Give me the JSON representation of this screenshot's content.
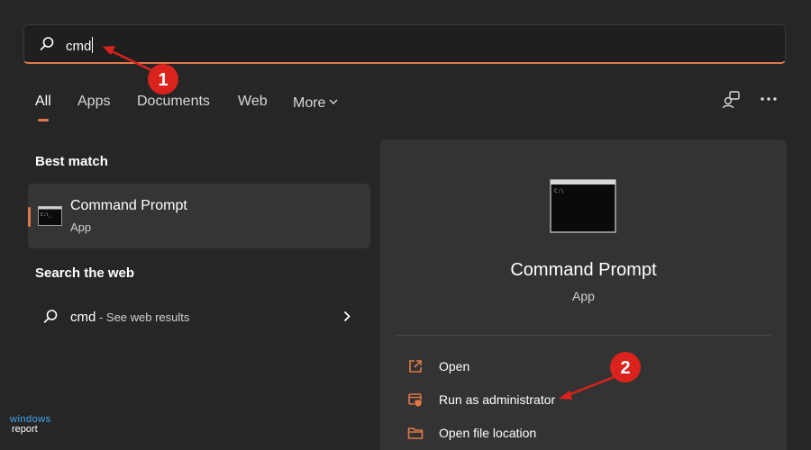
{
  "search": {
    "query": "cmd"
  },
  "tabs": [
    {
      "label": "All"
    },
    {
      "label": "Apps"
    },
    {
      "label": "Documents"
    },
    {
      "label": "Web"
    },
    {
      "label": "More"
    }
  ],
  "sections": {
    "best_match": "Best match",
    "search_web": "Search the web"
  },
  "best_match": {
    "title": "Command Prompt",
    "subtitle": "App"
  },
  "web_result": {
    "query": "cmd",
    "suffix": " - See web results"
  },
  "detail": {
    "title": "Command Prompt",
    "subtitle": "App",
    "actions": [
      {
        "label": "Open",
        "icon": "open-icon"
      },
      {
        "label": "Run as administrator",
        "icon": "shield-icon"
      },
      {
        "label": "Open file location",
        "icon": "folder-icon"
      }
    ]
  },
  "annotations": [
    {
      "number": "1"
    },
    {
      "number": "2"
    }
  ],
  "watermark": {
    "line1": "windows",
    "line2": "report"
  },
  "colors": {
    "accent": "#e07a48",
    "annotation_red": "#d9231c",
    "background": "#262626",
    "panel": "#333333"
  }
}
